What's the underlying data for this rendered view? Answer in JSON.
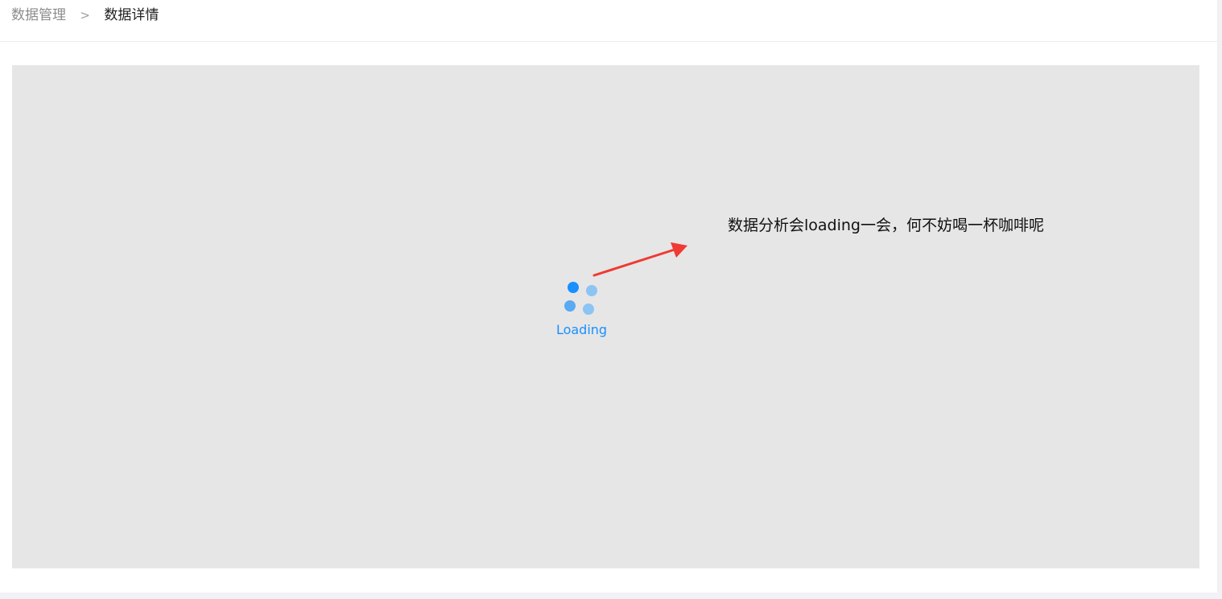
{
  "breadcrumb": {
    "items": [
      {
        "label": "数据管理"
      },
      {
        "label": "数据详情"
      }
    ],
    "separator": ">"
  },
  "main": {
    "loading": {
      "text": "Loading",
      "colors": [
        "#1890ff",
        "#8cc4f4",
        "#5aa9f3",
        "#8cc4f4"
      ]
    },
    "annotation": {
      "text": "数据分析会loading一会，何不妨喝一杯咖啡呢",
      "arrow_color": "#f03a34"
    },
    "background_color": "#e6e6e6"
  }
}
